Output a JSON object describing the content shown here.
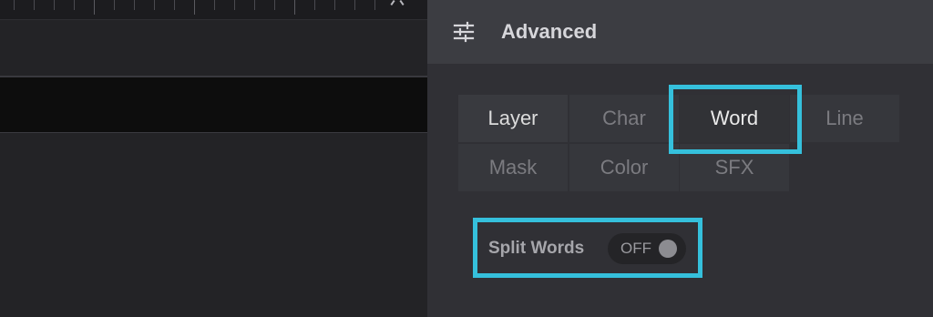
{
  "panel": {
    "title": "Advanced",
    "icon": "sliders-icon"
  },
  "tabs": [
    {
      "label": "Layer",
      "state": "selected"
    },
    {
      "label": "Char",
      "state": "inactive"
    },
    {
      "label": "Word",
      "state": "active"
    },
    {
      "label": "Line",
      "state": "inactive"
    },
    {
      "label": "Mask",
      "state": "inactive"
    },
    {
      "label": "Color",
      "state": "inactive"
    },
    {
      "label": "SFX",
      "state": "inactive"
    }
  ],
  "split_words": {
    "label": "Split Words",
    "toggle_text": "OFF",
    "value": false
  },
  "colors": {
    "highlight": "#35c0dc",
    "panel_bg": "#303035",
    "header_bg": "#3c3d42"
  }
}
